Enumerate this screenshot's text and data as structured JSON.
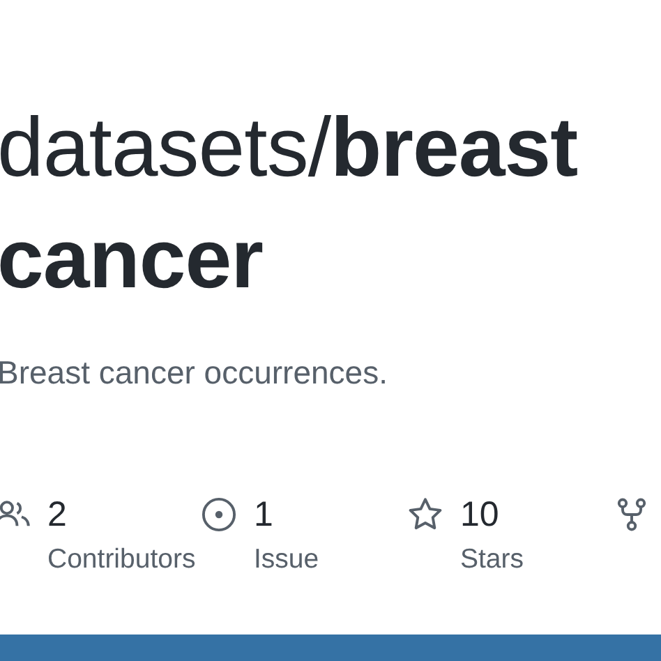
{
  "repo": {
    "owner": "datasets/",
    "name_line_1": "breast",
    "name_line_2": "cancer"
  },
  "description": "Breast cancer occurrences.",
  "stats": [
    {
      "kind": "contributors",
      "value": "2",
      "label": "Contributors"
    },
    {
      "kind": "issues",
      "value": "1",
      "label": "Issue"
    },
    {
      "kind": "stars",
      "value": "10",
      "label": "Stars"
    },
    {
      "kind": "forks"
    }
  ]
}
